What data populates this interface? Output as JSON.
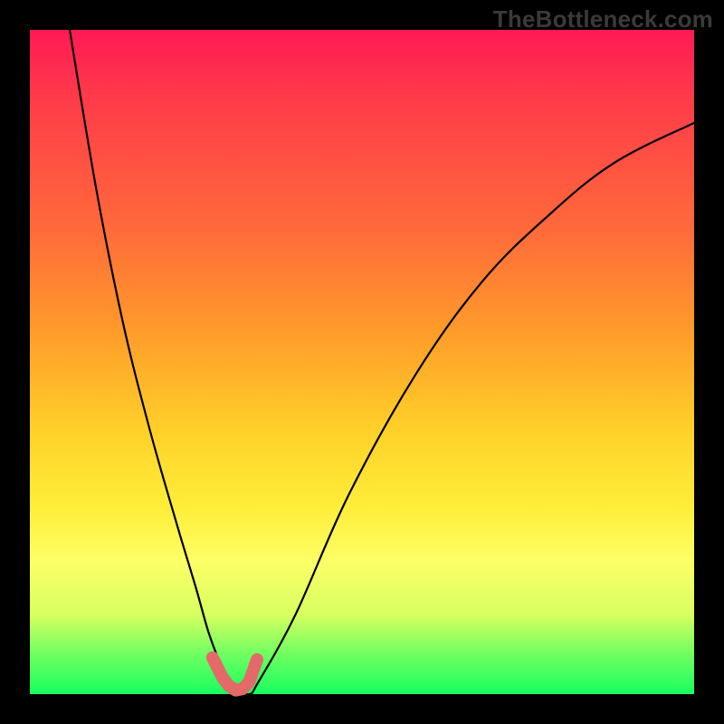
{
  "watermark": "TheBottleneck.com",
  "chart_data": {
    "type": "line",
    "title": "",
    "xlabel": "",
    "ylabel": "",
    "xlim": [
      0,
      100
    ],
    "ylim": [
      0,
      100
    ],
    "grid": false,
    "legend": false,
    "note": "V-shaped bottleneck curve on a red→green vertical heat background; numeric values estimated from pixel positions (higher y = worse mismatch).",
    "series": [
      {
        "name": "curve",
        "x": [
          6,
          10,
          14,
          18,
          22,
          25,
          27,
          29,
          31,
          33,
          34.5,
          40,
          48,
          58,
          68,
          78,
          88,
          100
        ],
        "y": [
          100,
          76,
          56,
          40,
          26,
          16,
          9,
          4,
          1,
          0,
          2,
          12,
          30,
          48,
          62,
          72,
          80,
          86
        ]
      }
    ],
    "vertex_markers": {
      "color": "#e46a6a",
      "stroke_width": 14,
      "points_x": [
        27.5,
        29,
        30,
        31,
        32,
        33,
        34.2
      ],
      "points_y": [
        5.5,
        2.5,
        1.2,
        0.6,
        0.8,
        1.8,
        5.2
      ]
    },
    "background_gradient": {
      "direction": "vertical",
      "stops": [
        {
          "pos": 0.0,
          "color": "#ff1a55"
        },
        {
          "pos": 0.3,
          "color": "#ff6a3a"
        },
        {
          "pos": 0.6,
          "color": "#ffd028"
        },
        {
          "pos": 0.8,
          "color": "#fcff66"
        },
        {
          "pos": 0.94,
          "color": "#6fff60"
        },
        {
          "pos": 1.0,
          "color": "#18ff60"
        }
      ]
    }
  }
}
